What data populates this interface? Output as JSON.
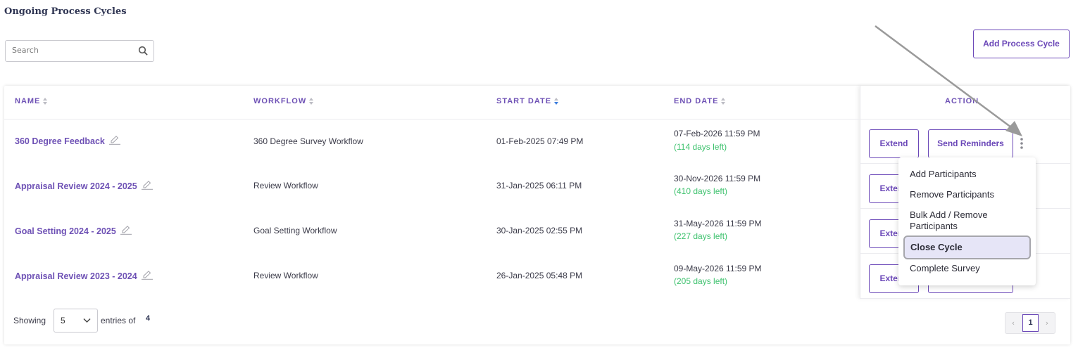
{
  "page": {
    "title": "Ongoing Process Cycles"
  },
  "search": {
    "placeholder": "Search"
  },
  "toolbar": {
    "add_label": "Add Process Cycle"
  },
  "table": {
    "headers": {
      "name": "NAME",
      "workflow": "WORKFLOW",
      "start_date": "START DATE",
      "end_date": "END DATE",
      "action": "ACTION"
    },
    "rows": [
      {
        "name": "360 Degree Feedback",
        "workflow": "360 Degree Survey Workflow",
        "start": "01-Feb-2025 07:49 PM",
        "end": "07-Feb-2026 11:59 PM",
        "days_left": "(114 days left)"
      },
      {
        "name": "Appraisal Review 2024 - 2025",
        "workflow": "Review Workflow",
        "start": "31-Jan-2025 06:11 PM",
        "end": "30-Nov-2026 11:59 PM",
        "days_left": "(410 days left)"
      },
      {
        "name": "Goal Setting 2024 - 2025",
        "workflow": "Goal Setting Workflow",
        "start": "30-Jan-2025 02:55 PM",
        "end": "31-May-2026 11:59 PM",
        "days_left": "(227 days left)"
      },
      {
        "name": "Appraisal Review 2023 - 2024",
        "workflow": "Review Workflow",
        "start": "26-Jan-2025 05:48 PM",
        "end": "09-May-2026 11:59 PM",
        "days_left": "(205 days left)"
      }
    ],
    "actions": {
      "extend": "Extend",
      "send_reminders": "Send Reminders"
    }
  },
  "menu": {
    "items": [
      "Add Participants",
      "Remove Participants",
      "Bulk Add / Remove Participants",
      "Close Cycle",
      "Complete Survey"
    ],
    "selected": "Close Cycle"
  },
  "footer": {
    "showing_label": "Showing",
    "page_size": "5",
    "entries_of_label": "entries of",
    "total": "4"
  },
  "pagination": {
    "current": "1",
    "prev": "‹",
    "next": "›"
  },
  "colors": {
    "accent": "#6b48b8",
    "days_left": "#3ec26e",
    "title": "#2f3553"
  }
}
